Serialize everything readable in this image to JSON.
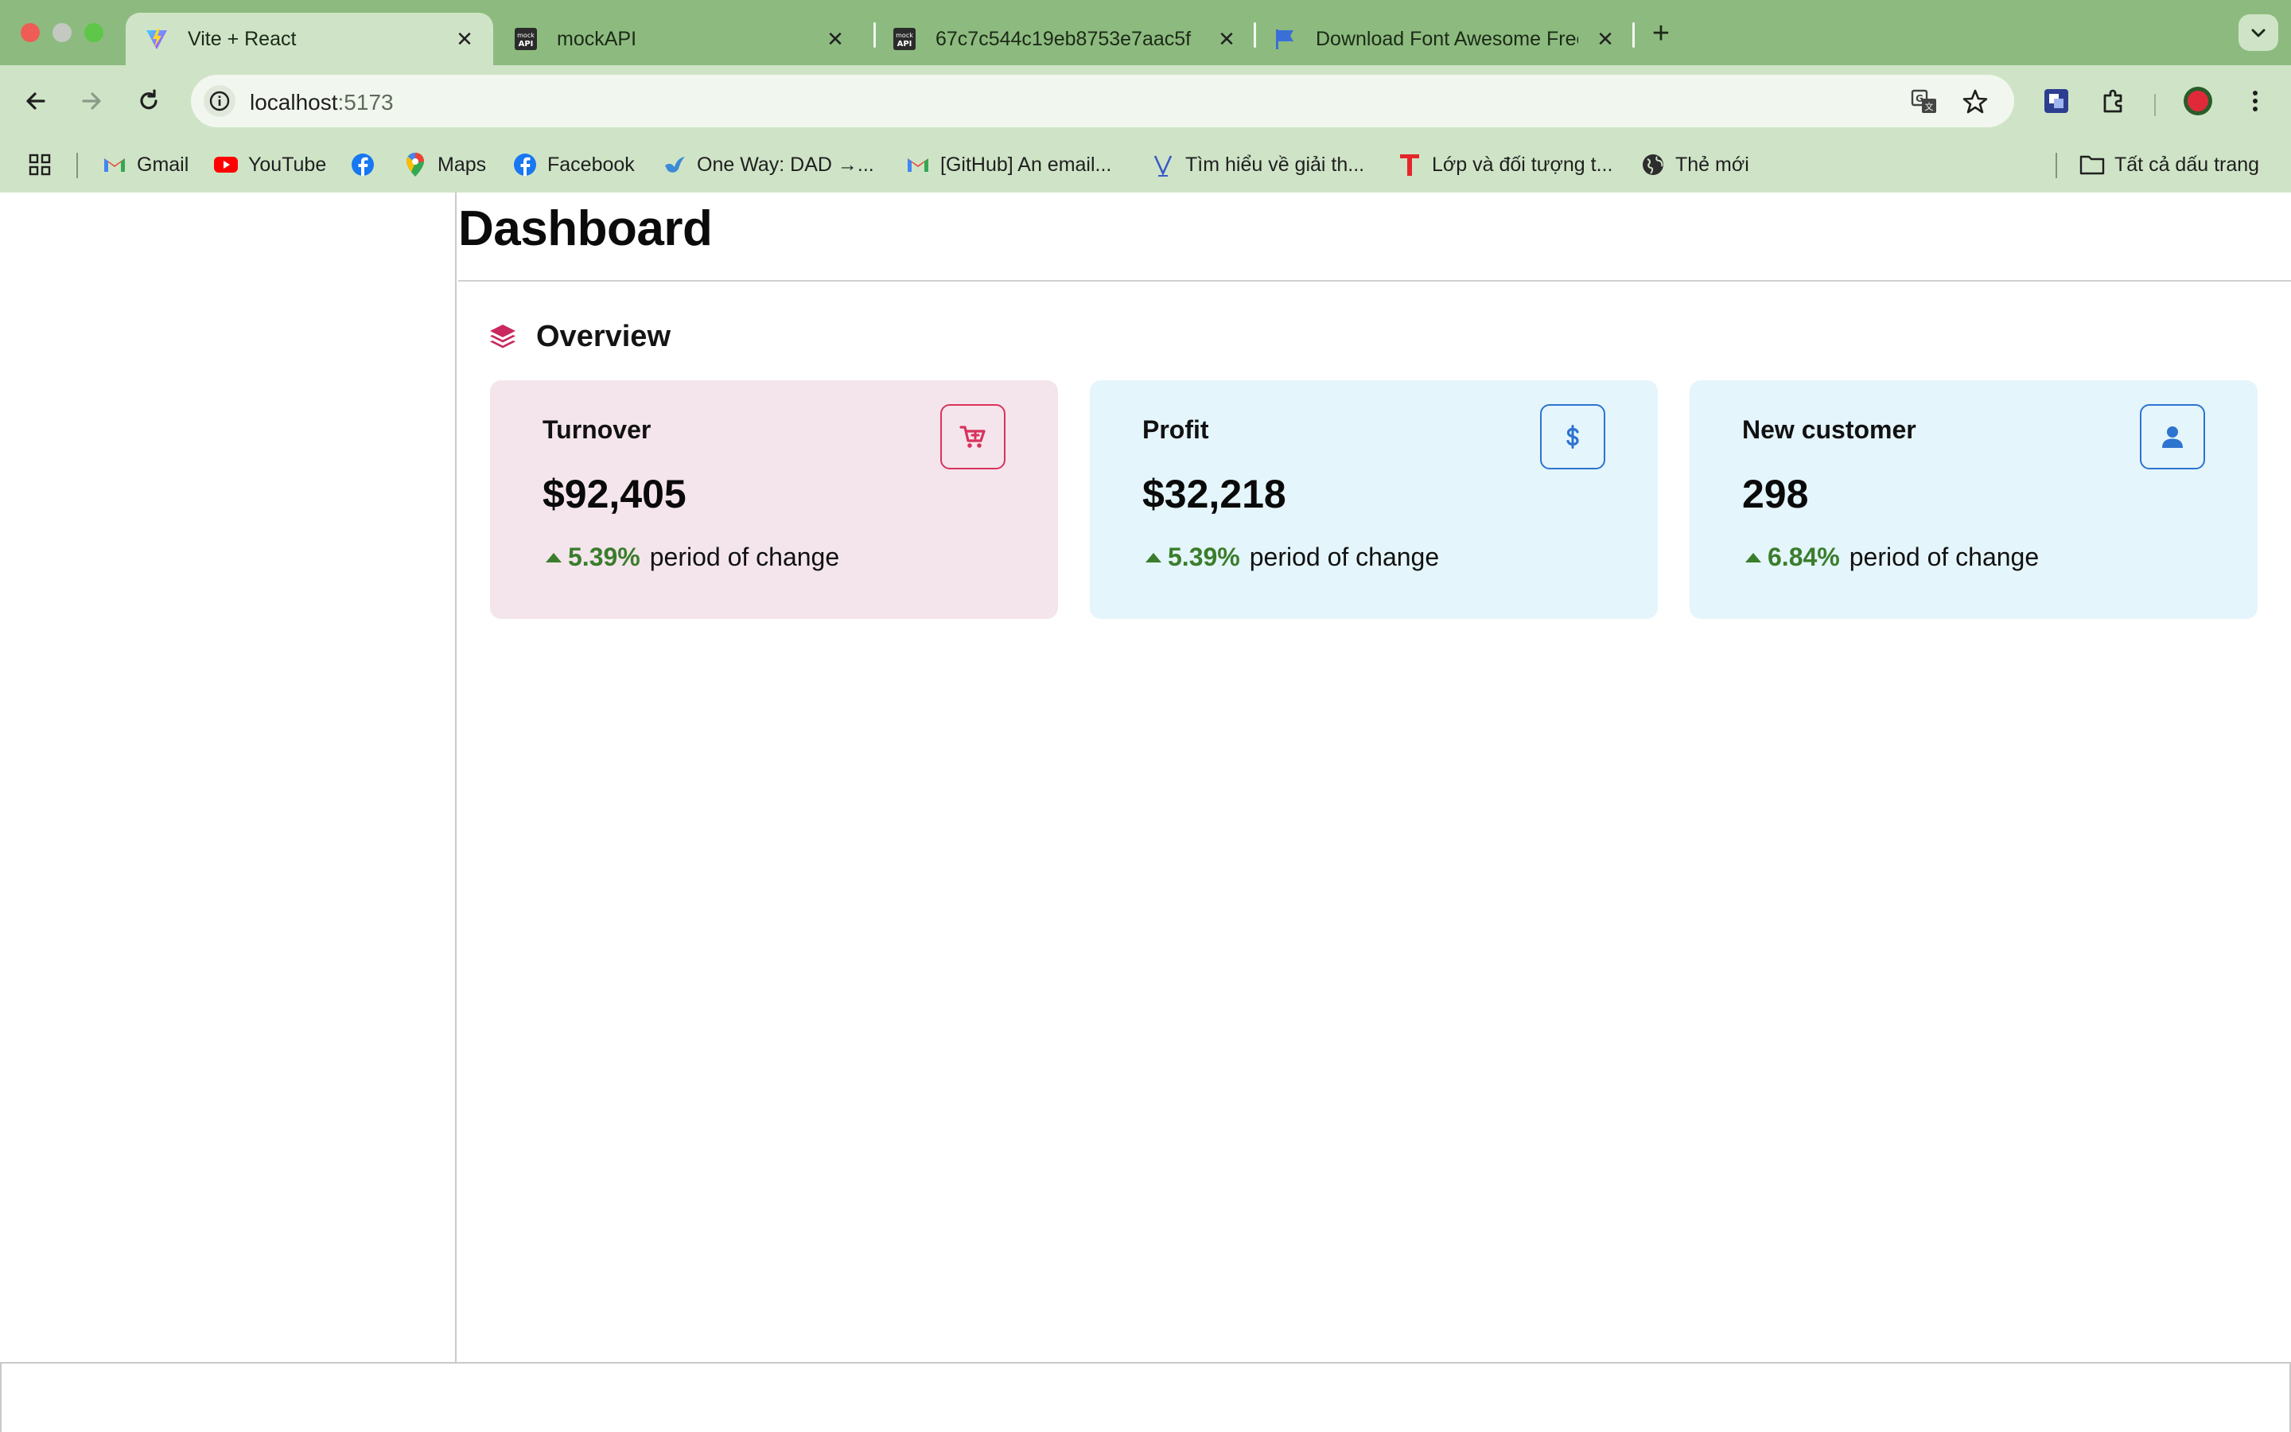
{
  "browser": {
    "tabs": [
      {
        "title": "Vite + React",
        "icon": "vite-icon",
        "active": true
      },
      {
        "title": "mockAPI",
        "icon": "mockapi-icon",
        "active": false
      },
      {
        "title": "67c7c544c19eb8753e7aac5f",
        "icon": "mockapi-icon",
        "active": false
      },
      {
        "title": "Download Font Awesome Free",
        "icon": "font-awesome-flag-icon",
        "active": false
      }
    ],
    "url_host": "localhost",
    "url_port": ":5173",
    "bookmarks": [
      {
        "label": "Gmail",
        "icon": "gmail-icon"
      },
      {
        "label": "YouTube",
        "icon": "youtube-icon"
      },
      {
        "label": "",
        "icon": "facebook-icon"
      },
      {
        "label": "Maps",
        "icon": "maps-icon"
      },
      {
        "label": "Facebook",
        "icon": "facebook-icon"
      },
      {
        "label": "One Way: DAD →...",
        "icon": "bird-icon"
      },
      {
        "label": "[GitHub] An email...",
        "icon": "gmail-icon"
      },
      {
        "label": "Tìm hiểu về giải th...",
        "icon": "v-icon"
      },
      {
        "label": "Lớp và đối tượng t...",
        "icon": "t-icon"
      },
      {
        "label": "Thẻ mới",
        "icon": "globe-icon"
      }
    ],
    "all_bookmarks": "Tất cả dấu trang"
  },
  "page": {
    "title": "Dashboard",
    "section_title": "Overview",
    "cards": [
      {
        "label": "Turnover",
        "value": "$92,405",
        "change": "5.39%",
        "change_text": "period of change",
        "icon": "cart-icon"
      },
      {
        "label": "Profit",
        "value": "$32,218",
        "change": "5.39%",
        "change_text": "period of change",
        "icon": "dollar-icon"
      },
      {
        "label": "New customer",
        "value": "298",
        "change": "6.84%",
        "change_text": "period of change",
        "icon": "user-icon"
      }
    ]
  },
  "colors": {
    "tabbar": "#8dbb7f",
    "toolbar": "#cfe4c7",
    "card_pink": "#f4e5ec",
    "card_blue": "#e4f5fb",
    "accent_pink": "#d8325d",
    "accent_blue": "#2d73d0",
    "positive_green": "#3a7d2c"
  }
}
